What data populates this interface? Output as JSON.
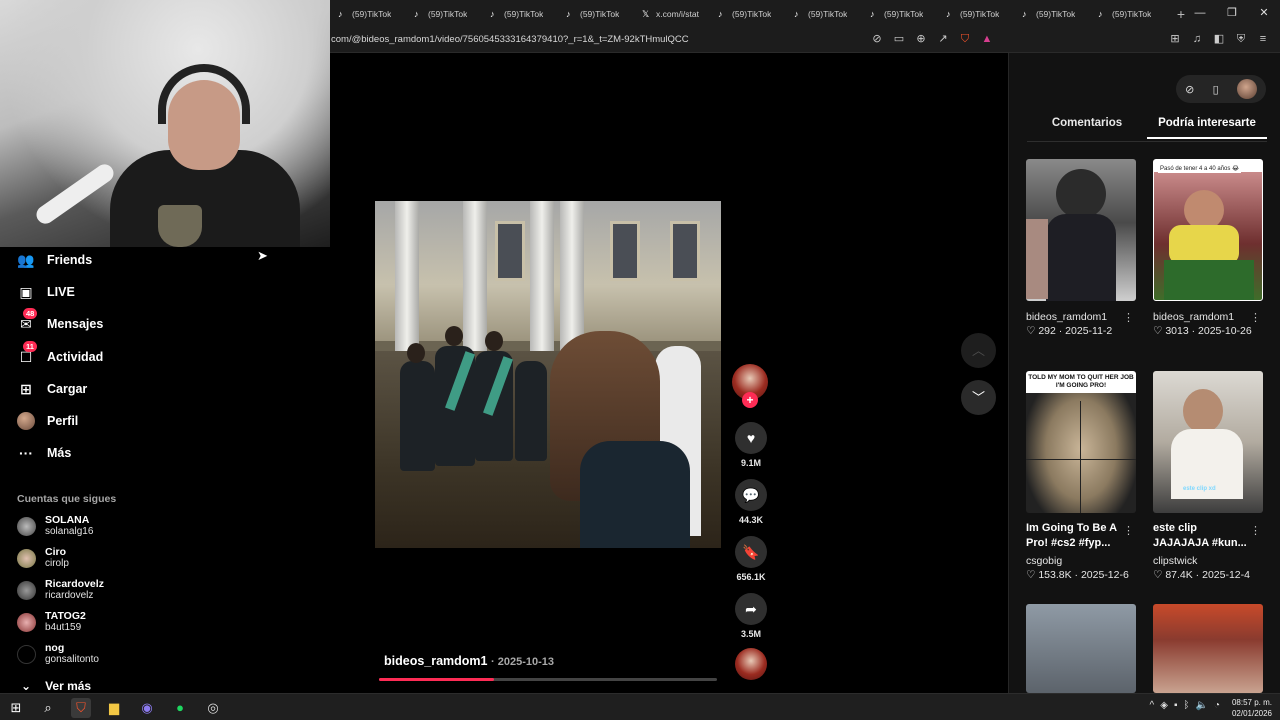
{
  "browser": {
    "tabs": [
      {
        "label": "(59)TikTok",
        "icon": "tiktok-icon"
      },
      {
        "label": "(59)TikTok",
        "icon": "tiktok-icon"
      },
      {
        "label": "(59)TikTok",
        "icon": "tiktok-icon"
      },
      {
        "label": "(59)TikTok",
        "icon": "tiktok-icon"
      },
      {
        "label": "x.com/i/stat",
        "icon": "x-icon"
      },
      {
        "label": "(59)TikTok",
        "icon": "tiktok-icon"
      },
      {
        "label": "(59)TikTok",
        "icon": "tiktok-icon"
      },
      {
        "label": "(59)TikTok",
        "icon": "tiktok-icon"
      },
      {
        "label": "(59)TikTok",
        "icon": "tiktok-icon"
      },
      {
        "label": "(59)TikTok",
        "icon": "tiktok-icon"
      },
      {
        "label": "(59)TikTok",
        "icon": "tiktok-icon"
      }
    ],
    "new_tab": "+",
    "url": "com/@bideos_ramdom1/video/7560545333164379410?_r=1&_t=ZM-92kTHmulQCC"
  },
  "sidebar": {
    "nav": [
      {
        "label": "Friends",
        "icon": "friends-icon",
        "badge": ""
      },
      {
        "label": "LIVE",
        "icon": "live-icon",
        "badge": ""
      },
      {
        "label": "Mensajes",
        "icon": "messages-icon",
        "badge": "48"
      },
      {
        "label": "Actividad",
        "icon": "activity-icon",
        "badge": "11"
      },
      {
        "label": "Cargar",
        "icon": "upload-icon",
        "badge": ""
      },
      {
        "label": "Perfil",
        "icon": "profile-avatar",
        "badge": ""
      },
      {
        "label": "Más",
        "icon": "more-icon",
        "badge": ""
      }
    ],
    "following_title": "Cuentas que sigues",
    "following": [
      {
        "name": "SOLANA",
        "user": "solanalg16"
      },
      {
        "name": "Ciro",
        "user": "cirolp"
      },
      {
        "name": "Ricardovelz",
        "user": "ricardovelz"
      },
      {
        "name": "TATOG2",
        "user": "b4ut159"
      },
      {
        "name": "nog",
        "user": "gonsalitonto"
      }
    ],
    "see_more": "Ver más"
  },
  "video": {
    "author": "bideos_ramdom1",
    "date": "· 2025-10-13",
    "progress": 0.34
  },
  "actions": {
    "likes": "9.1M",
    "comments": "44.3K",
    "saves": "656.1K",
    "shares": "3.5M"
  },
  "right_panel": {
    "tabs": [
      "Comentarios",
      "Podría interesarte"
    ],
    "active_tab": 1,
    "cards": [
      {
        "title": "",
        "user": "bideos_ramdom1",
        "stats": "♡ 292 · 2025-11-2"
      },
      {
        "title": "",
        "user": "bideos_ramdom1",
        "stats": "♡ 3013 · 2025-10-26",
        "thumb_text": "Pasó de tener 4 a 40 años 😂"
      },
      {
        "title": "Im Going To Be A Pro! #cs2 #fyp...",
        "user": "csgobig",
        "stats": "♡ 153.8K · 2025-12-6",
        "thumb_text": "TOLD MY MOM TO QUIT HER JOB I'M GOING PRO!"
      },
      {
        "title": "este clip JAJAJAJA #kun...",
        "user": "clipstwick",
        "stats": "♡ 87.4K · 2025-12-4",
        "thumb_text": "este clip xd"
      }
    ]
  },
  "taskbar": {
    "time": "08:57 p. m.",
    "date": "02/01/2026"
  },
  "colors": {
    "accent": "#fe2c55",
    "panel": "#121212"
  }
}
